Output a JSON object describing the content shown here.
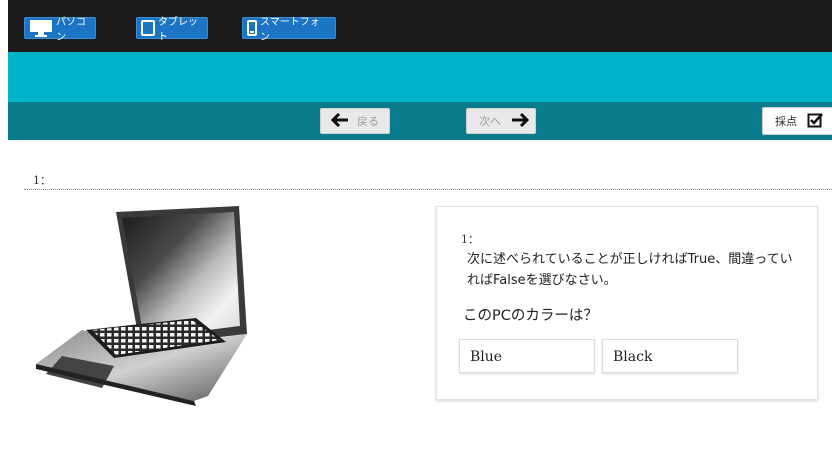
{
  "device_tabs": [
    {
      "label": "パソコン",
      "icon": "desktop-icon"
    },
    {
      "label": "タブレット",
      "icon": "tablet-icon"
    },
    {
      "label": "スマートフォン",
      "icon": "smartphone-icon"
    }
  ],
  "nav": {
    "back_label": "戻る",
    "next_label": "次へ",
    "score_label": "採点"
  },
  "question": {
    "number_label": "1：",
    "card_number": "1：",
    "instruction": "次に述べられていることが正しければTrue、間違っていればFalseを選びなさい。",
    "prompt": "このPCのカラーは？",
    "choices": [
      "Blue",
      "Black"
    ]
  },
  "colors": {
    "top_bar": "#1b1b1b",
    "device_button": "#1b74c4",
    "cyan_band": "#00b4cc",
    "nav_bar": "#087c8c"
  }
}
